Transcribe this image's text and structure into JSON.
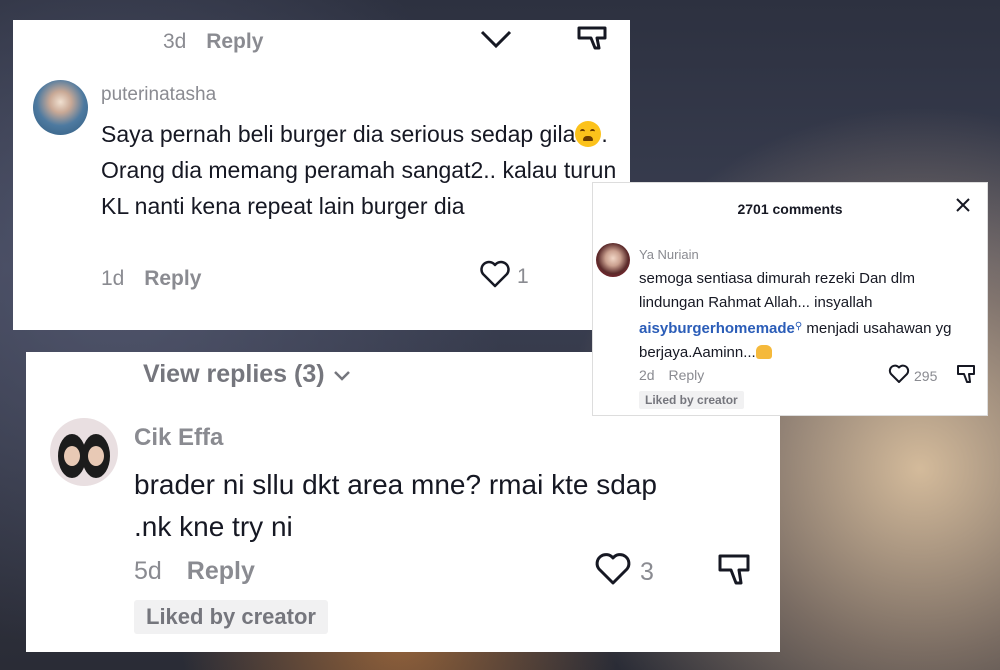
{
  "card1": {
    "top_meta": {
      "time": "3d",
      "reply": "Reply"
    },
    "comment": {
      "username": "puterinatasha",
      "text_part1": "Saya pernah beli burger dia serious sedap gila",
      "text_part2": ". Orang dia memang peramah sangat2.. kalau turun KL nanti kena repeat lain burger dia",
      "time": "1d",
      "reply": "Reply",
      "likes": "1"
    }
  },
  "card2": {
    "view_replies": "View replies (3)",
    "comment": {
      "username": "Cik Effa",
      "text": "brader ni sllu dkt area mne? rmai kte sdap .nk kne try ni",
      "time": "5d",
      "reply": "Reply",
      "likes": "3",
      "badge": "Liked by creator"
    }
  },
  "card3": {
    "header": "2701 comments",
    "comment": {
      "username": "Ya Nuriain",
      "text_part1": "semoga sentiasa dimurah rezeki Dan dlm lindungan Rahmat Allah... insyallah",
      "mention": "aisyburgerhomemade",
      "text_part2": "menjadi usahawan yg berjaya.Aaminn...",
      "time": "2d",
      "reply": "Reply",
      "likes": "295",
      "badge": "Liked by creator"
    }
  },
  "colors": {
    "text": "#161823",
    "muted": "#8a8b91",
    "mention": "#2b5db8",
    "badge_bg": "#f1f1f2"
  },
  "icons": [
    "chevron-down-icon",
    "dislike-icon",
    "heart-icon",
    "close-icon",
    "emoji-weary-icon",
    "emoji-hands-icon"
  ]
}
